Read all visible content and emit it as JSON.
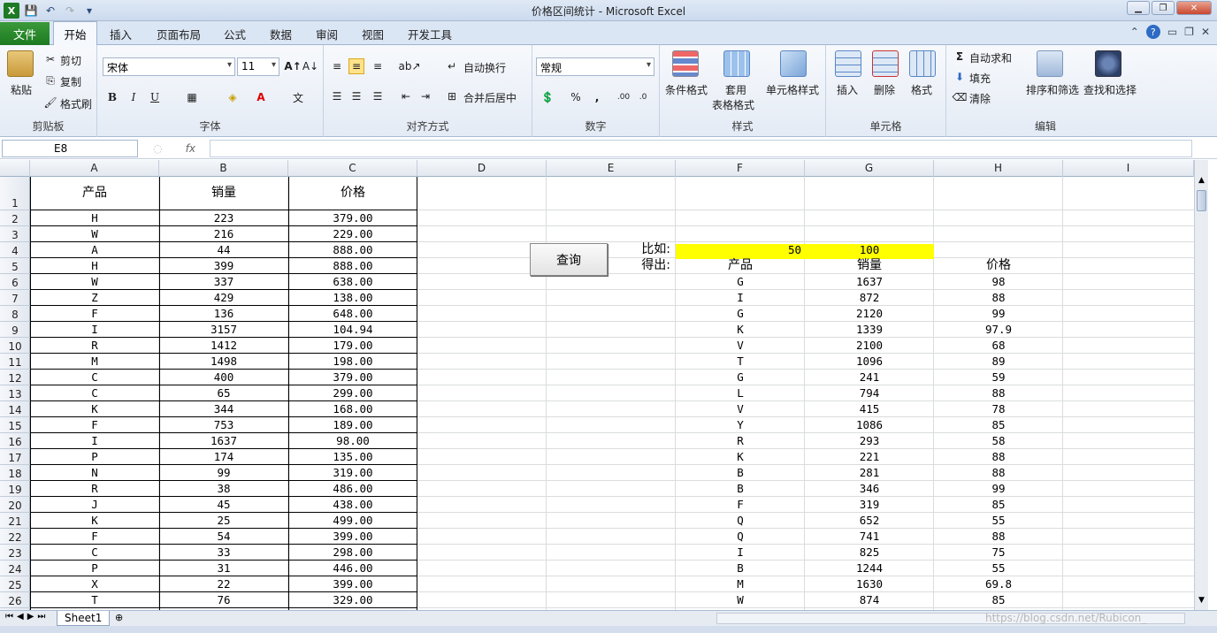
{
  "window": {
    "title": "价格区间统计 - Microsoft Excel"
  },
  "ribbon_tabs": {
    "file": "文件",
    "home": "开始",
    "insert": "插入",
    "page_layout": "页面布局",
    "formulas": "公式",
    "data": "数据",
    "review": "审阅",
    "view": "视图",
    "developer": "开发工具"
  },
  "clipboard": {
    "paste": "粘贴",
    "cut": "剪切",
    "copy": "复制",
    "format_painter": "格式刷",
    "label": "剪贴板"
  },
  "font": {
    "name": "宋体",
    "size": "11",
    "bold": "B",
    "italic": "I",
    "underline": "U",
    "label": "字体"
  },
  "alignment": {
    "wrap": "自动换行",
    "merge": "合并后居中",
    "label": "对齐方式"
  },
  "number": {
    "format": "常规",
    "label": "数字"
  },
  "styles": {
    "conditional": "条件格式",
    "table_1": "套用",
    "table_2": "表格格式",
    "cell_styles": "单元格样式",
    "label": "样式"
  },
  "cells": {
    "insert": "插入",
    "delete": "删除",
    "format": "格式",
    "label": "单元格"
  },
  "editing": {
    "autosum": "自动求和",
    "fill": "填充",
    "clear": "清除",
    "sort": "排序和筛选",
    "find": "查找和选择",
    "label": "编辑"
  },
  "formula_bar": {
    "name_box": "E8",
    "fx": "fx",
    "content": ""
  },
  "columns": [
    "A",
    "B",
    "C",
    "D",
    "E",
    "F",
    "G",
    "H",
    "I"
  ],
  "rows": [
    "1",
    "2",
    "3",
    "4",
    "5",
    "6",
    "7",
    "8",
    "9",
    "10",
    "11",
    "12",
    "13",
    "14",
    "15",
    "16",
    "17",
    "18",
    "19",
    "20",
    "21",
    "22",
    "23",
    "24",
    "25",
    "26"
  ],
  "table_left": {
    "headers": [
      "产品",
      "销量",
      "价格"
    ],
    "rows": [
      [
        "H",
        "223",
        "379.00"
      ],
      [
        "W",
        "216",
        "229.00"
      ],
      [
        "A",
        "44",
        "888.00"
      ],
      [
        "H",
        "399",
        "888.00"
      ],
      [
        "W",
        "337",
        "638.00"
      ],
      [
        "Z",
        "429",
        "138.00"
      ],
      [
        "F",
        "136",
        "648.00"
      ],
      [
        "I",
        "3157",
        "104.94"
      ],
      [
        "R",
        "1412",
        "179.00"
      ],
      [
        "M",
        "1498",
        "198.00"
      ],
      [
        "C",
        "400",
        "379.00"
      ],
      [
        "C",
        "65",
        "299.00"
      ],
      [
        "K",
        "344",
        "168.00"
      ],
      [
        "F",
        "753",
        "189.00"
      ],
      [
        "I",
        "1637",
        "98.00"
      ],
      [
        "P",
        "174",
        "135.00"
      ],
      [
        "N",
        "99",
        "319.00"
      ],
      [
        "R",
        "38",
        "486.00"
      ],
      [
        "J",
        "45",
        "438.00"
      ],
      [
        "K",
        "25",
        "499.00"
      ],
      [
        "F",
        "54",
        "399.00"
      ],
      [
        "C",
        "33",
        "298.00"
      ],
      [
        "P",
        "31",
        "446.00"
      ],
      [
        "X",
        "22",
        "399.00"
      ],
      [
        "T",
        "76",
        "329.00"
      ]
    ]
  },
  "query_button": "查询",
  "criteria": {
    "label_example": "比如:",
    "label_result": "得出:",
    "low": "50",
    "high": "100"
  },
  "table_right": {
    "headers": [
      "产品",
      "销量",
      "价格"
    ],
    "rows": [
      [
        "G",
        "1637",
        "98"
      ],
      [
        "I",
        "872",
        "88"
      ],
      [
        "G",
        "2120",
        "99"
      ],
      [
        "K",
        "1339",
        "97.9"
      ],
      [
        "V",
        "2100",
        "68"
      ],
      [
        "T",
        "1096",
        "89"
      ],
      [
        "G",
        "241",
        "59"
      ],
      [
        "L",
        "794",
        "88"
      ],
      [
        "V",
        "415",
        "78"
      ],
      [
        "Y",
        "1086",
        "85"
      ],
      [
        "R",
        "293",
        "58"
      ],
      [
        "K",
        "221",
        "88"
      ],
      [
        "B",
        "281",
        "88"
      ],
      [
        "B",
        "346",
        "99"
      ],
      [
        "F",
        "319",
        "85"
      ],
      [
        "Q",
        "652",
        "55"
      ],
      [
        "Q",
        "741",
        "88"
      ],
      [
        "I",
        "825",
        "75"
      ],
      [
        "B",
        "1244",
        "55"
      ],
      [
        "M",
        "1630",
        "69.8"
      ],
      [
        "W",
        "874",
        "85"
      ]
    ]
  },
  "sheet_tabs": [
    "Sheet1"
  ],
  "watermark": "https://blog.csdn.net/Rubicon_",
  "colors": {
    "highlight": "#ffff00",
    "file_tab": "#2a8a2d"
  }
}
